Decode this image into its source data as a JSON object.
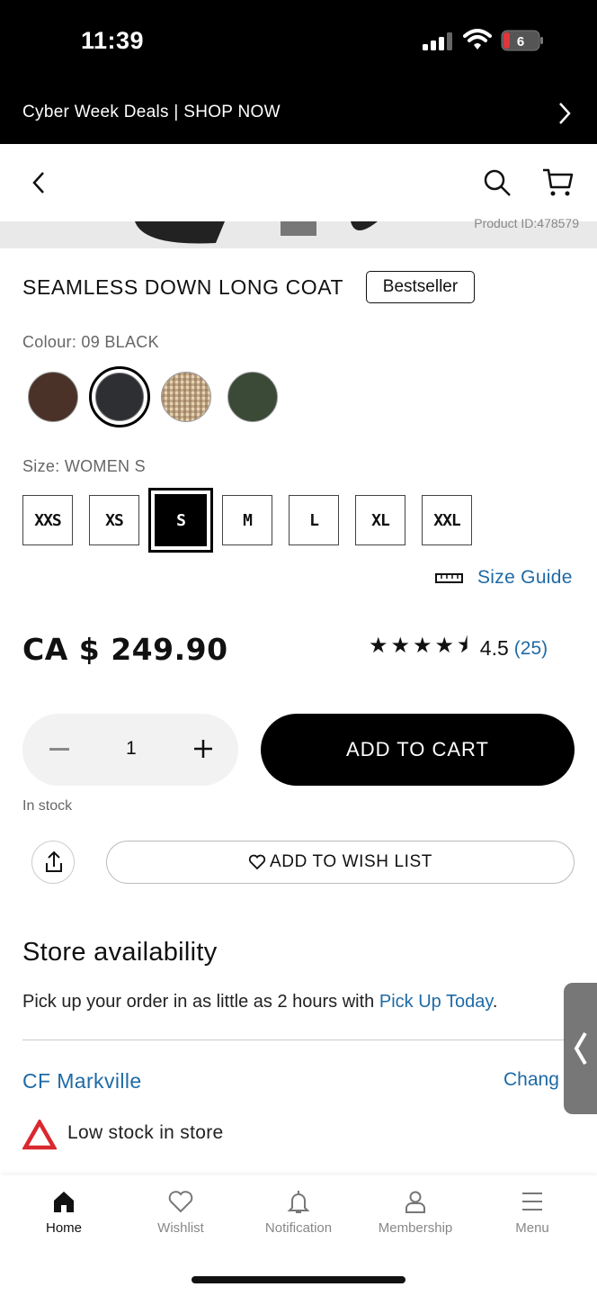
{
  "status_bar": {
    "time": "11:39",
    "battery": "6"
  },
  "promo": {
    "text": "Cyber Week Deals | SHOP NOW"
  },
  "product": {
    "id_label": "Product ID:478579",
    "title": "SEAMLESS DOWN LONG COAT",
    "badge": "Bestseller",
    "colour_label": "Colour: 09 BLACK",
    "colours": [
      {
        "name": "brown",
        "hex": "#4a3229"
      },
      {
        "name": "black",
        "hex": "#2d2f32",
        "selected": true
      },
      {
        "name": "beige-check",
        "hex": "#c9b08e"
      },
      {
        "name": "dark-green",
        "hex": "#3a4a37"
      }
    ],
    "size_label": "Size: WOMEN S",
    "sizes": [
      "XXS",
      "XS",
      "S",
      "M",
      "L",
      "XL",
      "XXL"
    ],
    "selected_size": "S",
    "size_guide": "Size Guide",
    "price": "CA $ 249.90",
    "rating_stars": "★★★★⯨",
    "rating_value": "4.5",
    "rating_count": "(25)"
  },
  "cart": {
    "quantity": "1",
    "add_to_cart": "ADD TO CART",
    "stock_status": "In stock",
    "wish_list": "ADD TO WISH LIST"
  },
  "store": {
    "title": "Store availability",
    "desc_prefix": "Pick up your order in as little as 2 hours with ",
    "desc_link": "Pick Up Today",
    "desc_suffix": ".",
    "store_name": "CF Markville",
    "change": "Chang",
    "stock_note": "Low stock in store"
  },
  "tabbar": {
    "items": [
      {
        "label": "Home",
        "icon": "home-icon",
        "active": true
      },
      {
        "label": "Wishlist",
        "icon": "heart-icon"
      },
      {
        "label": "Notification",
        "icon": "bell-icon"
      },
      {
        "label": "Membership",
        "icon": "person-icon"
      },
      {
        "label": "Menu",
        "icon": "menu-icon"
      }
    ]
  },
  "colors": {
    "link": "#1f6aa5",
    "primary": "#000000",
    "warning": "#d9282f"
  }
}
